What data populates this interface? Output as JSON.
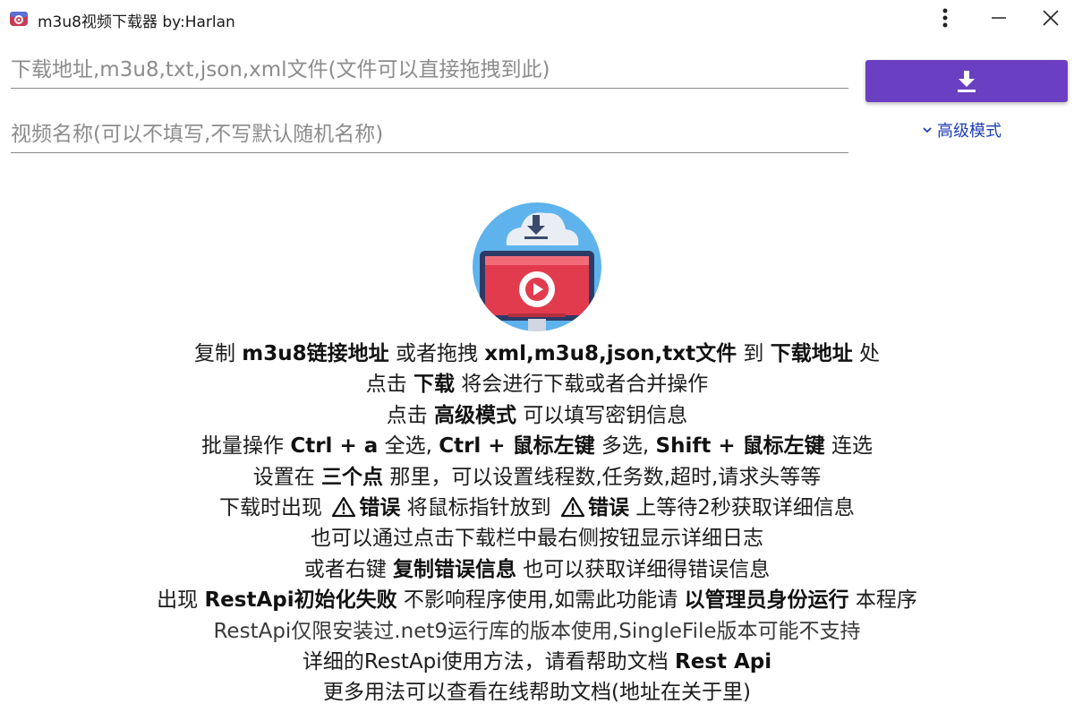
{
  "window": {
    "title": "m3u8视频下载器 by:Harlan"
  },
  "inputs": {
    "url_placeholder": "下载地址,m3u8,txt,json,xml文件(文件可以直接拖拽到此)",
    "name_placeholder": "视频名称(可以不填写,不写默认随机名称)"
  },
  "actions": {
    "download_icon": "download-icon",
    "advanced_label": "高级模式"
  },
  "help": {
    "l1": [
      "复制 ",
      "m3u8链接地址",
      " 或者拖拽 ",
      "xml,m3u8,json,txt文件",
      " 到 ",
      "下载地址",
      " 处"
    ],
    "l2": [
      "点击 ",
      "下载",
      " 将会进行下载或者合并操作"
    ],
    "l3": [
      "点击 ",
      "高级模式",
      " 可以填写密钥信息"
    ],
    "l4": [
      "批量操作 ",
      "Ctrl + a",
      " 全选, ",
      "Ctrl + 鼠标左键",
      " 多选, ",
      "Shift + 鼠标左键",
      " 连选"
    ],
    "l5": [
      "设置在 ",
      "三个点",
      " 那里，可以设置线程数,任务数,超时,请求头等等"
    ],
    "l6": [
      "下载时出现 ",
      "错误",
      " 将鼠标指针放到 ",
      "错误",
      " 上等待2秒获取详细信息"
    ],
    "l7": "也可以通过点击下载栏中最右侧按钮显示详细日志",
    "l8": [
      "或者右键 ",
      "复制错误信息",
      " 也可以获取详细得错误信息"
    ],
    "l9": [
      "出现 ",
      "RestApi初始化失败",
      " 不影响程序使用,如需此功能请 ",
      "以管理员身份运行",
      " 本程序"
    ],
    "l10": "RestApi仅限安装过.net9运行库的版本使用,SingleFile版本可能不支持",
    "l11": [
      "详细的RestApi使用方法，请看帮助文档 ",
      "Rest Api"
    ],
    "l12": "更多用法可以查看在线帮助文档(地址在关于里)"
  },
  "colors": {
    "accent": "#6b3fc2",
    "link": "#1f3fb5",
    "illustration_circle": "#5fb3ec",
    "screen_red": "#e23b4e"
  }
}
